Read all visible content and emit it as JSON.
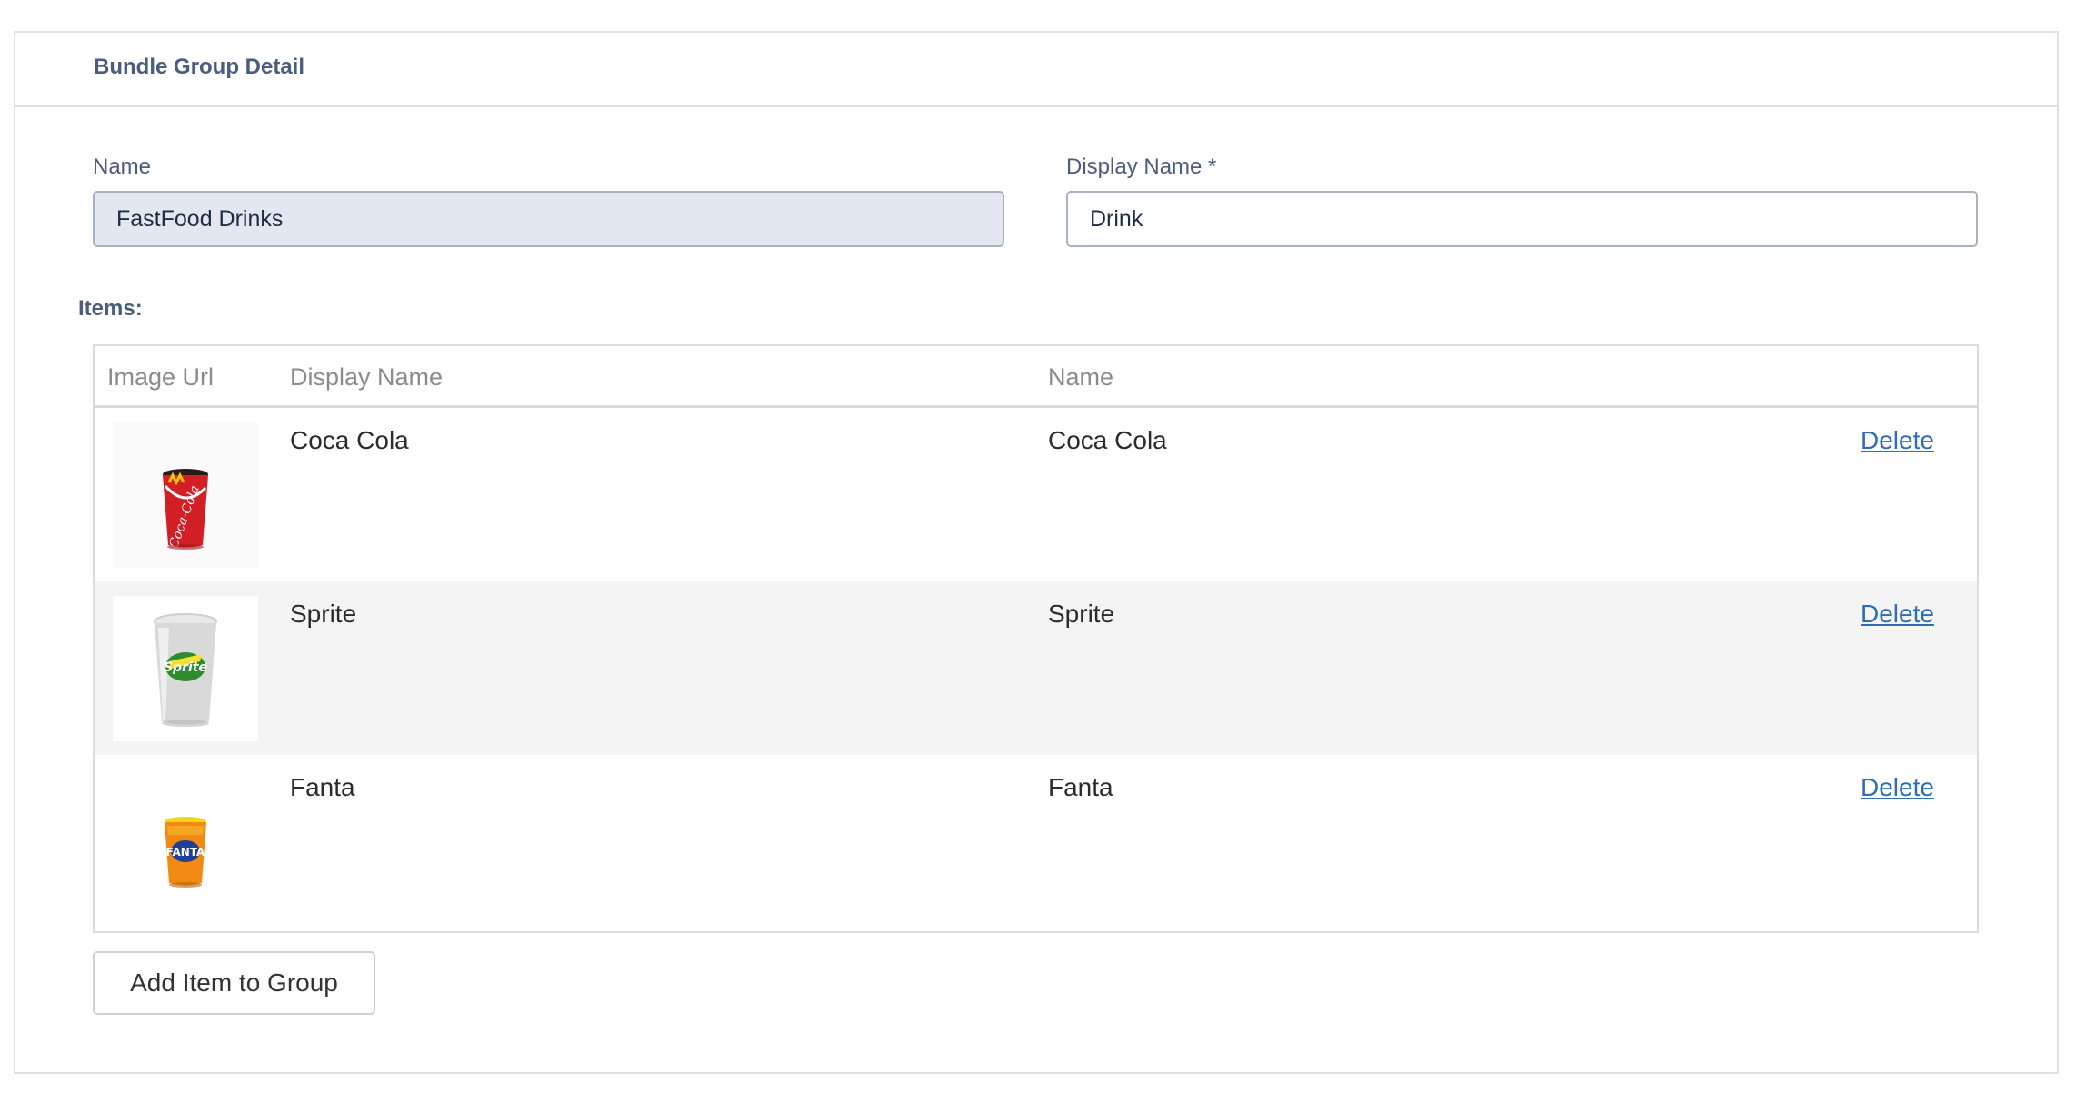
{
  "card": {
    "title": "Bundle Group Detail"
  },
  "form": {
    "name_label": "Name",
    "name_value": "FastFood Drinks",
    "display_name_label": "Display Name *",
    "display_name_value": "Drink"
  },
  "items_label": "Items:",
  "table": {
    "columns": [
      "Image Url",
      "Display Name",
      "Name"
    ],
    "rows": [
      {
        "image": "coca-cola-cup-image",
        "cup_color": "#d21f26",
        "display_name": "Coca Cola",
        "name": "Coca Cola",
        "action": "Delete"
      },
      {
        "image": "sprite-cup-image",
        "cup_color": "#d9d9d9",
        "display_name": "Sprite",
        "name": "Sprite",
        "action": "Delete"
      },
      {
        "image": "fanta-cup-image",
        "cup_color": "#f08a12",
        "display_name": "Fanta",
        "name": "Fanta",
        "action": "Delete"
      }
    ]
  },
  "add_button_label": "Add Item to Group",
  "colors": {
    "label": "#4a5d7e",
    "link": "#2f6db5",
    "readonly_bg": "#e3e7ef",
    "stripe_bg": "#f4f4f4"
  }
}
